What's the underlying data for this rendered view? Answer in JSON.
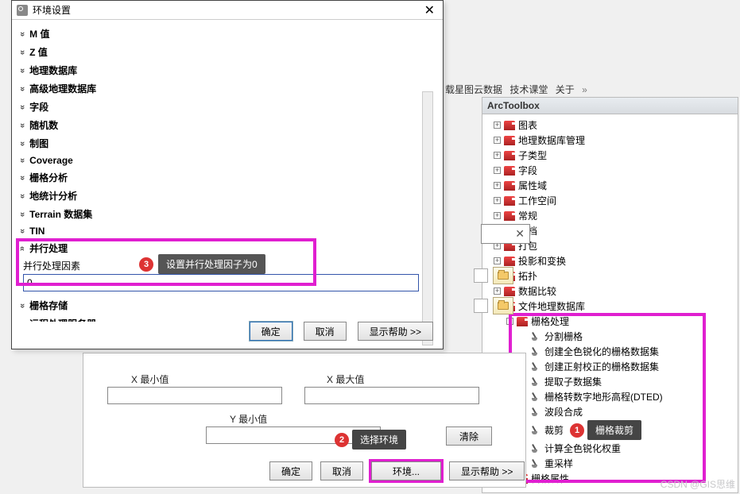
{
  "menu": {
    "items": [
      "载星图云数据",
      "技术课堂",
      "关于"
    ]
  },
  "toolbox": {
    "title": "ArcToolbox",
    "nodes": [
      "图表",
      "地理数据库管理",
      "子类型",
      "字段",
      "属性域",
      "工作空间",
      "常规",
      "归档",
      "打包",
      "投影和变换",
      "拓扑",
      "数据比较",
      "文件地理数据库"
    ],
    "rasterProc": {
      "label": "栅格处理",
      "children": [
        "分割栅格",
        "创建全色锐化的栅格数据集",
        "创建正射校正的栅格数据集",
        "提取子数据集",
        "栅格转数字地形高程(DTED)",
        "波段合成",
        "裁剪",
        "计算全色锐化权重",
        "重采样"
      ]
    },
    "rasterAttr": "栅格属性"
  },
  "callouts": {
    "c1": {
      "num": "1",
      "text": "栅格裁剪"
    },
    "c2": {
      "num": "2",
      "text": "选择环境"
    },
    "c3": {
      "num": "3",
      "text": "设置并行处理因子为0"
    }
  },
  "lower": {
    "xmin": "X 最小值",
    "xmax": "X 最大值",
    "ymin": "Y 最小值",
    "clear": "清除",
    "ok": "确定",
    "cancel": "取消",
    "env": "环境...",
    "help": "显示帮助 >>"
  },
  "env": {
    "title": "环境设置",
    "sections": [
      "M 值",
      "Z 值",
      "地理数据库",
      "高级地理数据库",
      "字段",
      "随机数",
      "制图",
      "Coverage",
      "栅格分析",
      "地统计分析",
      "Terrain 数据集",
      "TIN"
    ],
    "parallel": {
      "header": "并行处理",
      "label": "并行处理因素",
      "value": "0"
    },
    "sections2": [
      "栅格存储",
      "远程处理服务器"
    ],
    "ok": "确定",
    "cancel": "取消",
    "help": "显示帮助 >>"
  },
  "watermark": "CSDN @GIS思维"
}
